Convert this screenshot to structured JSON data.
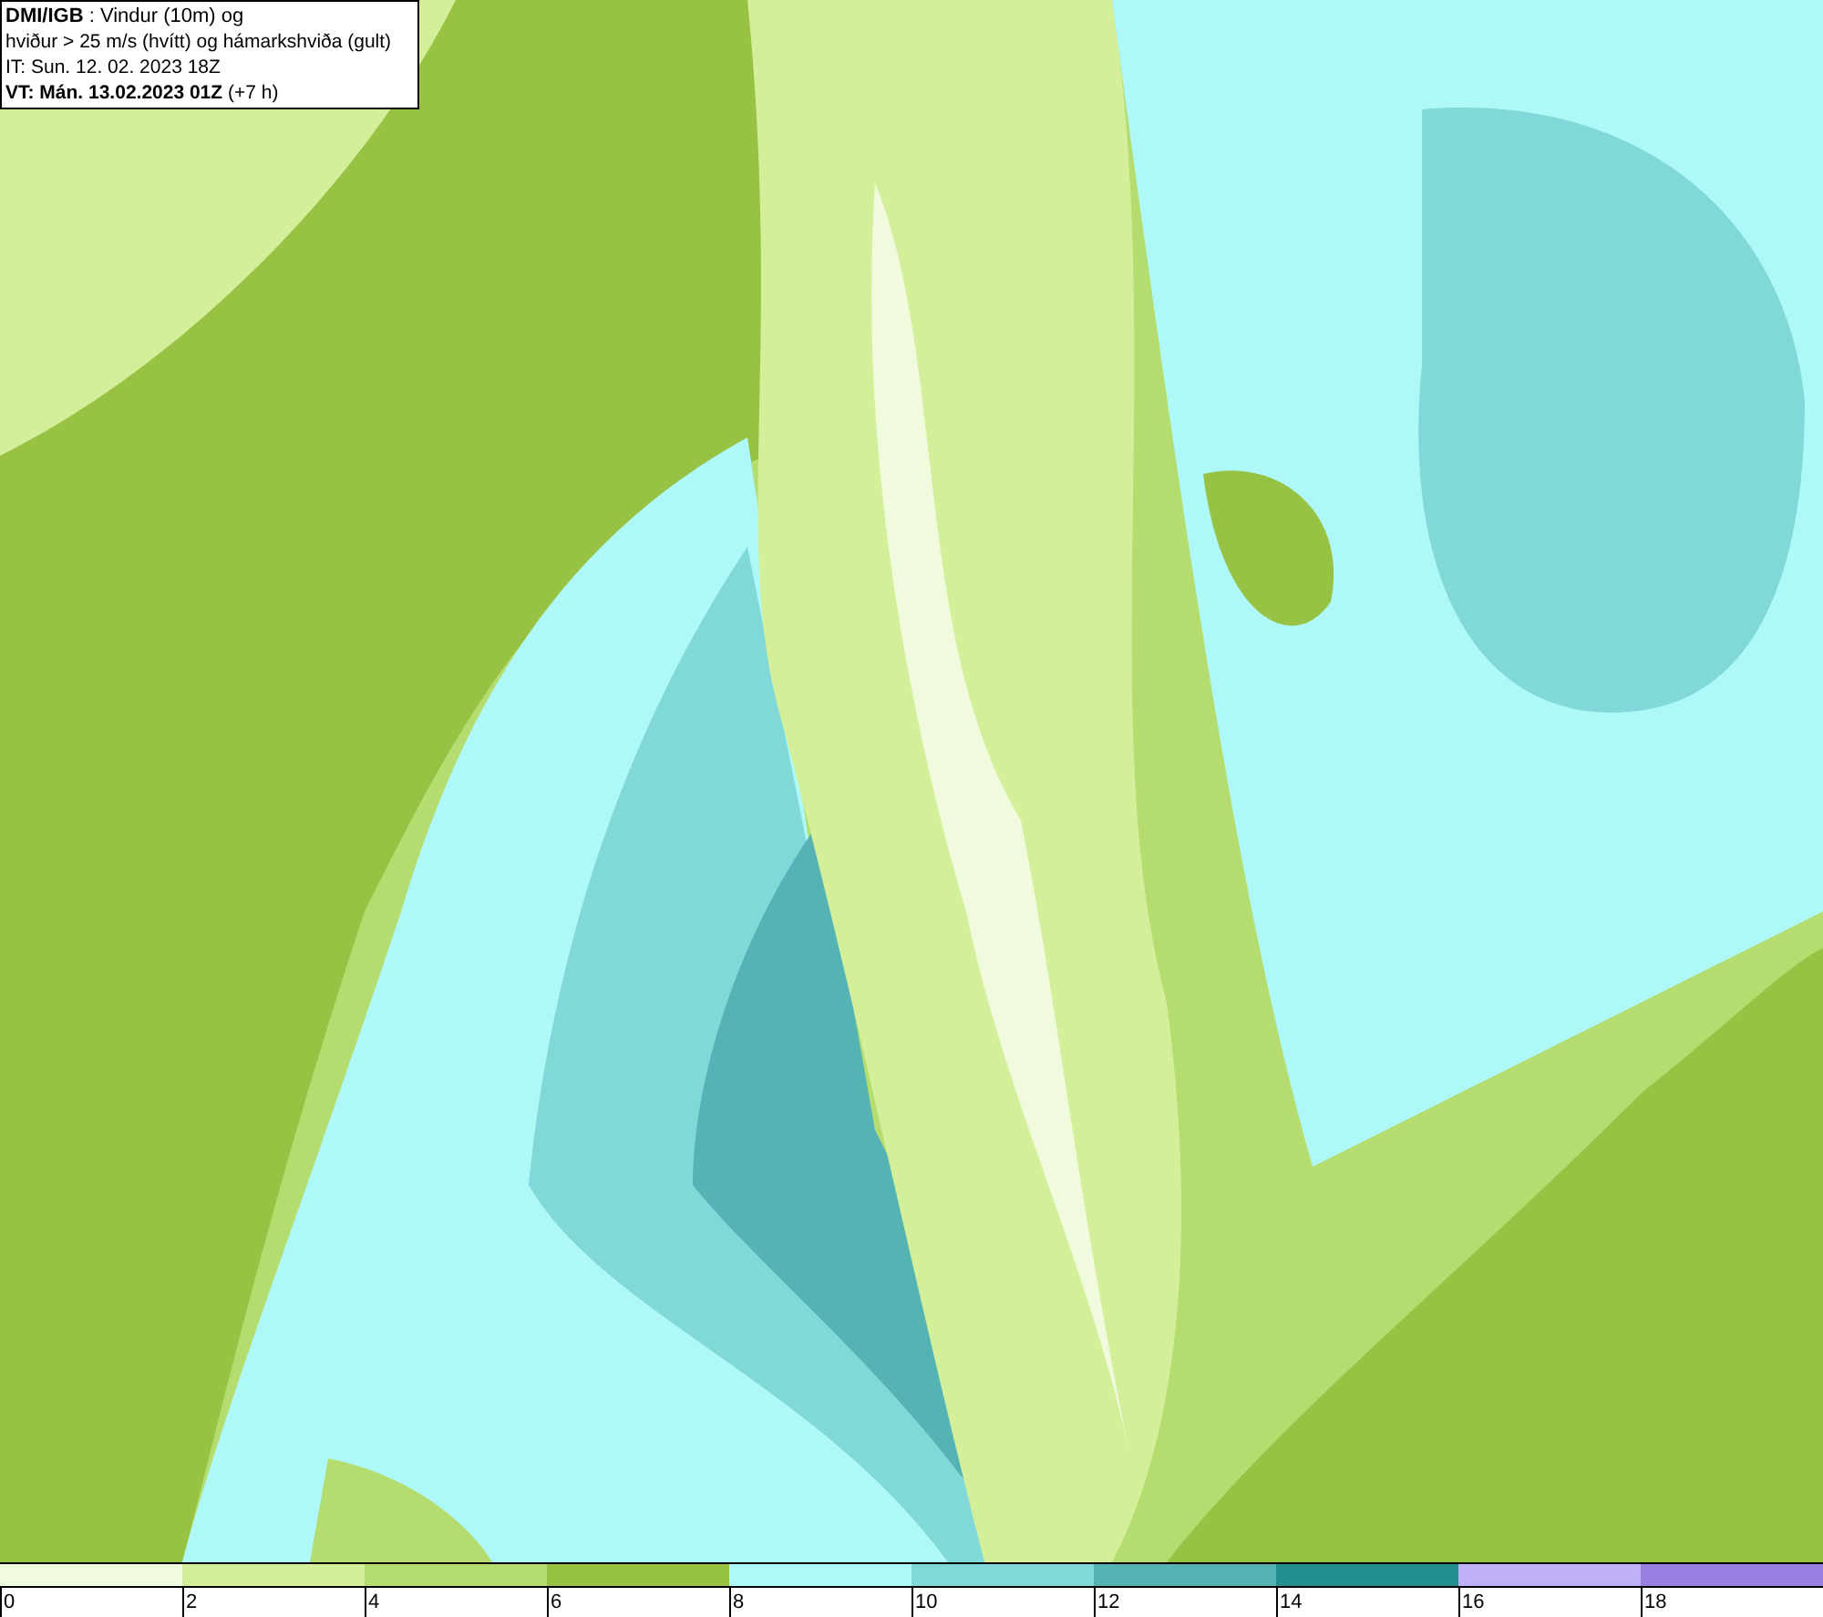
{
  "header": {
    "lines": [
      "**DMI/IGB** : Vindur (10m) og",
      "hviður > 25 m/s (hvítt) og hámarkshviða (gult)",
      "IT: Sun. 12. 02. 2023 18Z",
      "**VT: Mán. 13.02.2023 01Z** (+7 h)"
    ]
  },
  "legend": {
    "swatches": [
      {
        "color": "#f0fadc",
        "label": "0"
      },
      {
        "color": "#d4ef9a",
        "label": "2"
      },
      {
        "color": "#b5dc6e",
        "label": "4"
      },
      {
        "color": "#98c244",
        "label": "6"
      },
      {
        "color": "#aef8f8",
        "label": "8"
      },
      {
        "color": "#80d8d8",
        "label": "10"
      },
      {
        "color": "#55b3b3",
        "label": "12"
      },
      {
        "color": "#248f8f",
        "label": "14"
      },
      {
        "color": "#c0b0f8",
        "label": "16"
      },
      {
        "color": "#9a80e0",
        "label": "18"
      }
    ]
  }
}
